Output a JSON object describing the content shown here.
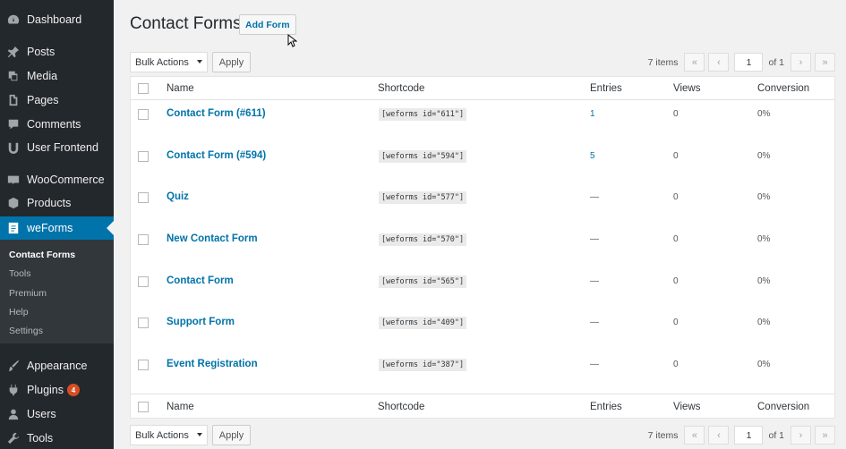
{
  "sidebar": {
    "items": [
      {
        "label": "Dashboard",
        "icon": "dashboard-icon"
      },
      {
        "label": "Posts",
        "icon": "pin-icon"
      },
      {
        "label": "Media",
        "icon": "media-icon"
      },
      {
        "label": "Pages",
        "icon": "pages-icon"
      },
      {
        "label": "Comments",
        "icon": "comment-icon"
      },
      {
        "label": "User Frontend",
        "icon": "frontend-icon"
      },
      {
        "label": "WooCommerce",
        "icon": "woo-icon"
      },
      {
        "label": "Products",
        "icon": "box-icon"
      },
      {
        "label": "weForms",
        "icon": "weforms-icon"
      },
      {
        "label": "Appearance",
        "icon": "brush-icon"
      },
      {
        "label": "Plugins",
        "icon": "plug-icon",
        "badge": "4"
      },
      {
        "label": "Users",
        "icon": "user-icon"
      },
      {
        "label": "Tools",
        "icon": "wrench-icon"
      }
    ],
    "submenu": [
      "Contact Forms",
      "Tools",
      "Premium",
      "Help",
      "Settings"
    ],
    "active_color": "#0073aa",
    "bg_color": "#23282d"
  },
  "header": {
    "title": "Contact Forms",
    "add_button": "Add Form"
  },
  "tablenav": {
    "bulk_actions": "Bulk Actions",
    "apply": "Apply",
    "items_count": "7 items",
    "first": "«",
    "prev": "‹",
    "page": "1",
    "of": "of 1",
    "next": "›",
    "last": "»"
  },
  "table": {
    "columns": [
      "Name",
      "Shortcode",
      "Entries",
      "Views",
      "Conversion"
    ],
    "rows": [
      {
        "name": "Contact Form (#611)",
        "shortcode": "[weforms id=\"611\"]",
        "entries": "1",
        "views": "0",
        "conversion": "0%"
      },
      {
        "name": "Contact Form (#594)",
        "shortcode": "[weforms id=\"594\"]",
        "entries": "5",
        "views": "0",
        "conversion": "0%"
      },
      {
        "name": "Quiz",
        "shortcode": "[weforms id=\"577\"]",
        "entries": "—",
        "views": "0",
        "conversion": "0%"
      },
      {
        "name": "New Contact Form",
        "shortcode": "[weforms id=\"570\"]",
        "entries": "—",
        "views": "0",
        "conversion": "0%"
      },
      {
        "name": "Contact Form",
        "shortcode": "[weforms id=\"565\"]",
        "entries": "—",
        "views": "0",
        "conversion": "0%"
      },
      {
        "name": "Support Form",
        "shortcode": "[weforms id=\"409\"]",
        "entries": "—",
        "views": "0",
        "conversion": "0%"
      },
      {
        "name": "Event Registration",
        "shortcode": "[weforms id=\"387\"]",
        "entries": "—",
        "views": "0",
        "conversion": "0%"
      }
    ]
  }
}
